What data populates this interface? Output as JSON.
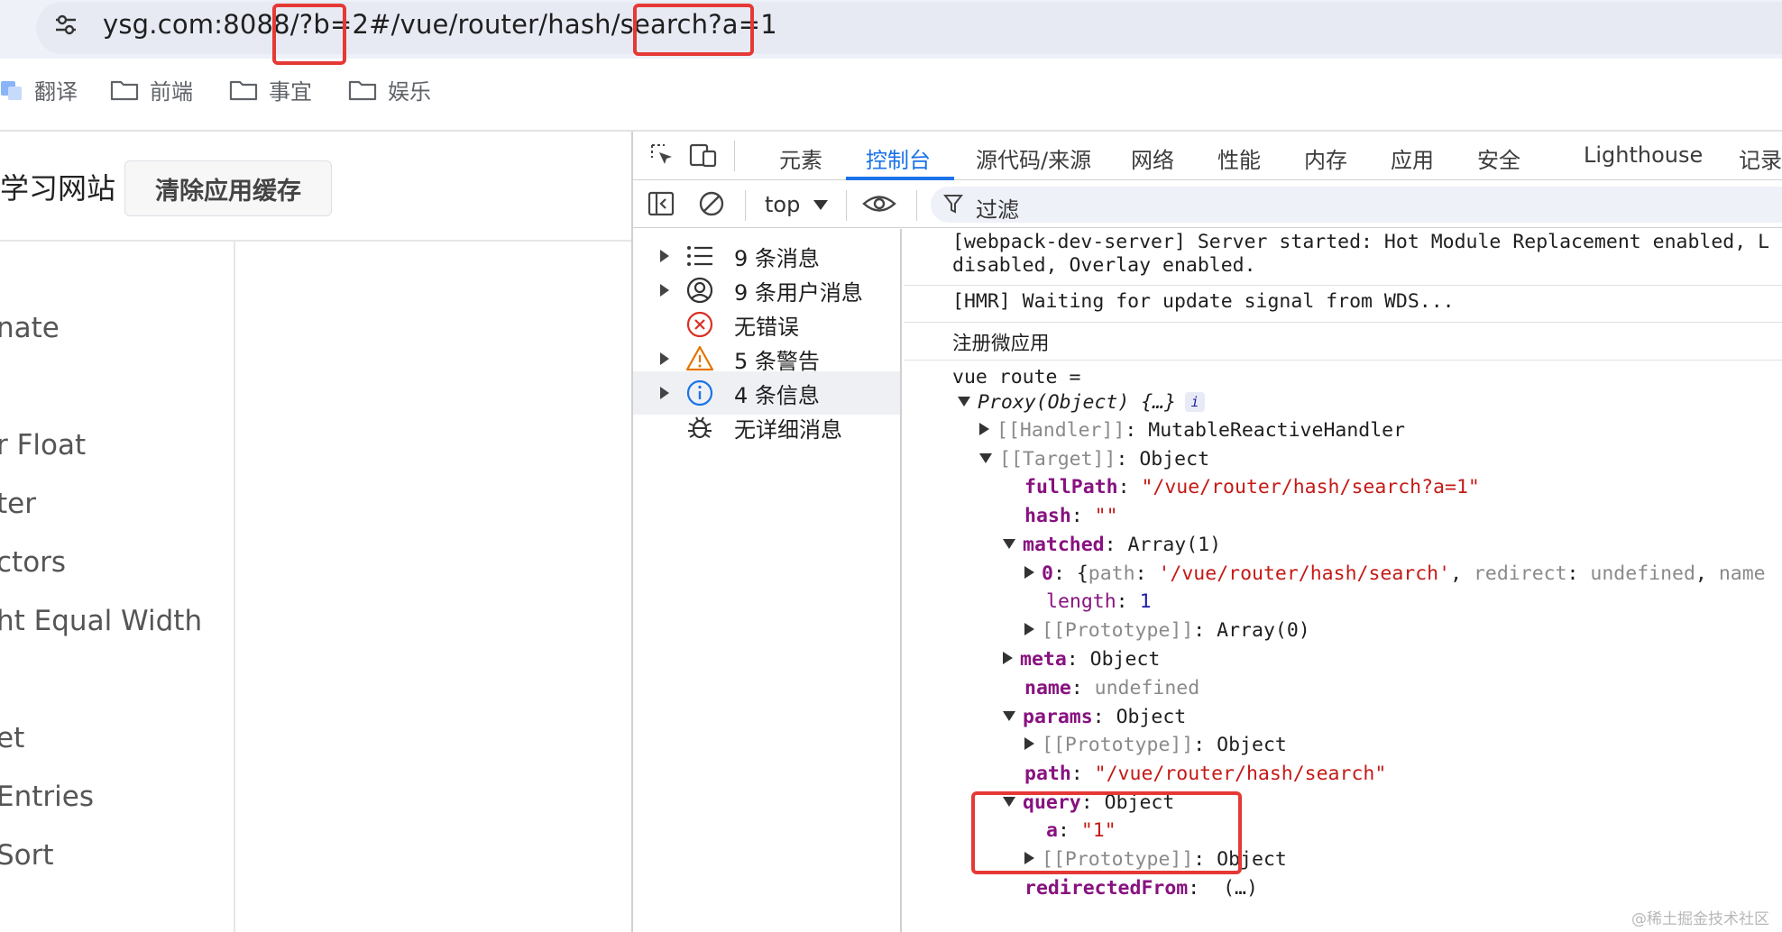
{
  "browser": {
    "url": "ysg.com:8088/?b=2#/vue/router/hash/search?a=1",
    "site_info_icon": "tune-icon",
    "bookmarks": [
      {
        "label": "翻译",
        "icon": "translate-icon"
      },
      {
        "label": "前端",
        "icon": "folder-icon"
      },
      {
        "label": "事宜",
        "icon": "folder-icon"
      },
      {
        "label": "娱乐",
        "icon": "folder-icon"
      }
    ]
  },
  "page": {
    "site_title": "学习网站",
    "clear_button": "清除应用缓存",
    "nav_items": [
      "nate",
      "r Float",
      "ter",
      "ctors",
      "ht Equal Width",
      "et",
      "Entries",
      "Sort"
    ]
  },
  "devtools": {
    "tabs": [
      "元素",
      "控制台",
      "源代码/来源",
      "网络",
      "性能",
      "内存",
      "应用",
      "安全",
      "Lighthouse",
      "记录"
    ],
    "active_tab": "控制台",
    "context": "top",
    "filter_placeholder": "过滤",
    "sidebar": [
      {
        "label": "9 条消息",
        "icon": "list-icon",
        "expandable": true
      },
      {
        "label": "9 条用户消息",
        "icon": "user-icon",
        "expandable": true
      },
      {
        "label": "无错误",
        "icon": "error-icon",
        "expandable": false
      },
      {
        "label": "5 条警告",
        "icon": "warning-icon",
        "expandable": true
      },
      {
        "label": "4 条信息",
        "icon": "info-icon",
        "expandable": true,
        "selected": true
      },
      {
        "label": "无详细消息",
        "icon": "bug-icon",
        "expandable": false
      }
    ],
    "console": {
      "msg1_line1": "[webpack-dev-server] Server started: Hot Module Replacement enabled, L",
      "msg1_line2": "disabled, Overlay enabled.",
      "msg2": "[HMR] Waiting for update signal from WDS...",
      "msg3": "注册微应用",
      "msg4_head": "vue route =",
      "proxy_label": "Proxy(Object) {…}",
      "info_badge": "i",
      "handler_key": "[[Handler]]",
      "handler_val": "MutableReactiveHandler",
      "target_key": "[[Target]]",
      "target_val": "Object",
      "fullpath_key": "fullPath",
      "fullpath_val": "\"/vue/router/hash/search?a=1\"",
      "hash_key": "hash",
      "hash_val": "\"\"",
      "matched_key": "matched",
      "matched_val": "Array(1)",
      "m0_key": "0",
      "m0_brace": "{",
      "m0_path_key": "path",
      "m0_path_val": "'/vue/router/hash/search'",
      "m0_redirect_key": "redirect",
      "m0_redirect_val": "undefined",
      "m0_name_key": "name",
      "length_key": "length",
      "length_val": "1",
      "proto_key": "[[Prototype]]",
      "proto_array_val": "Array(0)",
      "meta_key": "meta",
      "meta_val": "Object",
      "name_key": "name",
      "name_val": "undefined",
      "params_key": "params",
      "params_val": "Object",
      "proto_object_val": "Object",
      "path_key": "path",
      "path_val": "\"/vue/router/hash/search\"",
      "query_key": "query",
      "query_val": "Object",
      "a_key": "a",
      "a_val": "\"1\"",
      "redirected_key": "redirectedFrom",
      "redirected_val": "(…)"
    }
  },
  "annotation_color": "#e53935",
  "watermark": "@稀土掘金技术社区"
}
